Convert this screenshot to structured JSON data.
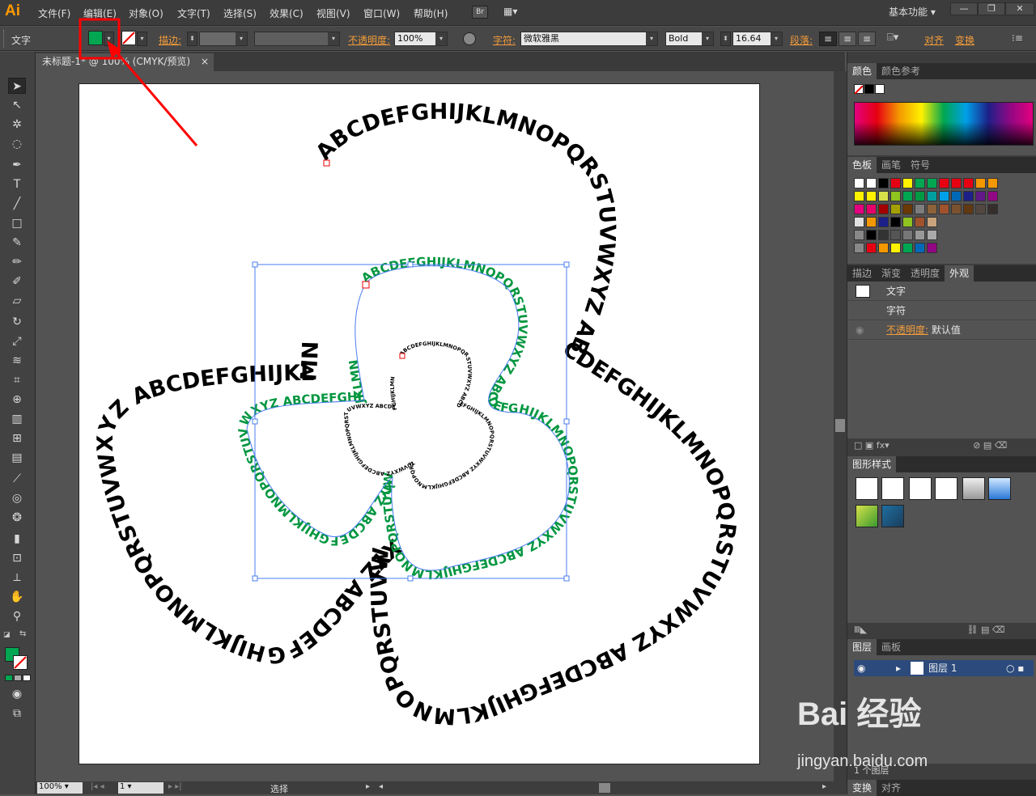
{
  "app": {
    "logo": "Ai"
  },
  "menu": [
    "文件(F)",
    "编辑(E)",
    "对象(O)",
    "文字(T)",
    "选择(S)",
    "效果(C)",
    "视图(V)",
    "窗口(W)",
    "帮助(H)"
  ],
  "menu_extra": {
    "bridge": "Br",
    "workspace": "基本功能"
  },
  "control": {
    "type_label": "文字",
    "stroke_label": "描边:",
    "opacity_label": "不透明度:",
    "opacity_value": "100%",
    "char_label": "字符:",
    "font_name": "微软雅黑",
    "font_style": "Bold",
    "font_size": "16.64",
    "para_label": "段落:",
    "align_label": "对齐",
    "transform_label": "变换"
  },
  "document": {
    "tab_title": "未标题-1* @ 100% (CMYK/预览)",
    "close": "×"
  },
  "artwork": {
    "text_outer": "ABCDEFGHIJKLMNOPQRSTUVWXYZ ABCDEFGHIJKLMNOPQRSTUVWXYZ ABCDEFGHIJKLMNOPQRSTUVWXYZ ABCDEFGHIJKLMNOPQRSTUVWXYZ ABCDEFGHIJKLMN",
    "text_middle": "ABCDEFGHIJKLMNOPQRSTUVWXYZ ABCDEFGHIJKLMNOPQRSTUVWXYZ ABCDEFGHIJKLMNOPQRSTUVWXYZ ABCDEFGHIJKLMNOPQRSTUVWXYZ ABCDEFGHIJKLMN",
    "text_inner": "ABCDEFGHIJKLMNOPQRSTUVWXYZ ABCDEFGHIJKLMNOPQRSTUVWXYZ ABCDEFGHIJKLMNOPQRSTUVWXYZ ABCDEFGHIJKLMNOPQRSTUVWXYZ ABCDEFGHIJKLMN",
    "outer_color": "#000000",
    "middle_color": "#00963f",
    "inner_color": "#000000"
  },
  "colors": {
    "fill": "#00a651",
    "highlight": "#ff0000",
    "orange": "#f39c3a"
  },
  "panels": {
    "color_tabs": [
      "颜色",
      "颜色参考"
    ],
    "swatch_tabs": [
      "色板",
      "画笔",
      "符号"
    ],
    "appearance_tabs": [
      "描边",
      "渐变",
      "透明度",
      "外观"
    ],
    "appearance_rows": [
      "文字",
      "字符"
    ],
    "opacity_row_label": "不透明度:",
    "opacity_row_value": "默认值",
    "graphic_styles": "图形样式",
    "layers_tabs": [
      "图层",
      "画板"
    ],
    "layer_name": "图层 1",
    "layer_count": "1 个图层",
    "bottom_tabs": [
      "变换",
      "对齐"
    ]
  },
  "status": {
    "zoom": "100%",
    "page": "1",
    "mode": "选择"
  },
  "watermark": {
    "brand": "Bai 经验",
    "url": "jingyan.baidu.com"
  }
}
